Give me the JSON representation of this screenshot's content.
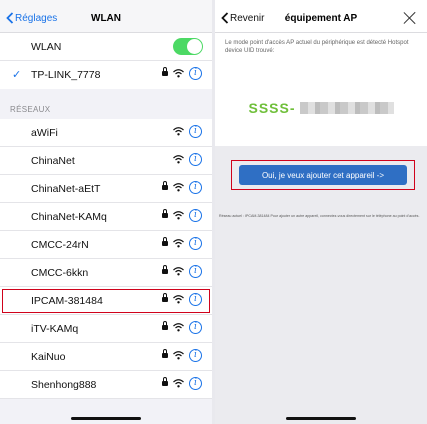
{
  "left": {
    "nav": {
      "back_label": "Réglages",
      "title": "WLAN"
    },
    "wlan_row": {
      "label": "WLAN",
      "toggle_on": true
    },
    "connected": {
      "label": "TP-LINK_7778",
      "secure": true
    },
    "section_label": "RÉSEAUX",
    "networks": [
      {
        "label": "aWiFi",
        "secure": false,
        "highlight": false
      },
      {
        "label": "ChinaNet",
        "secure": false,
        "highlight": false
      },
      {
        "label": "ChinaNet-aEtT",
        "secure": true,
        "highlight": false
      },
      {
        "label": "ChinaNet-KAMq",
        "secure": true,
        "highlight": false
      },
      {
        "label": "CMCC-24rN",
        "secure": true,
        "highlight": false
      },
      {
        "label": "CMCC-6kkn",
        "secure": true,
        "highlight": false
      },
      {
        "label": "IPCAM-381484",
        "secure": true,
        "highlight": true
      },
      {
        "label": "iTV-KAMq",
        "secure": true,
        "highlight": false
      },
      {
        "label": "KaiNuo",
        "secure": true,
        "highlight": false
      },
      {
        "label": "Shenhong888",
        "secure": true,
        "highlight": false
      }
    ]
  },
  "right": {
    "nav": {
      "back_label": "Revenir",
      "title": "équipement AP"
    },
    "description": "Le mode point d'accès AP actuel du périphérique est détecté Hotspot device UID trouvé:",
    "ssid_prefix": "SSSS-",
    "confirm_button": "Oui, je veux ajouter cet appareil ->",
    "note": "Réseau actuel : IPCAM-381484 Pour ajouter un autre appareil, connectez-vous directement sur le téléphone au point d'accès."
  },
  "colors": {
    "accent": "#1a73e8",
    "toggle": "#4cd964",
    "highlight": "#d0021b",
    "button": "#2f6fc4",
    "ssid": "#6fbf3a"
  },
  "icons": [
    "chevron-left-icon",
    "checkmark-icon",
    "lock-icon",
    "wifi-icon",
    "info-icon",
    "close-icon"
  ]
}
